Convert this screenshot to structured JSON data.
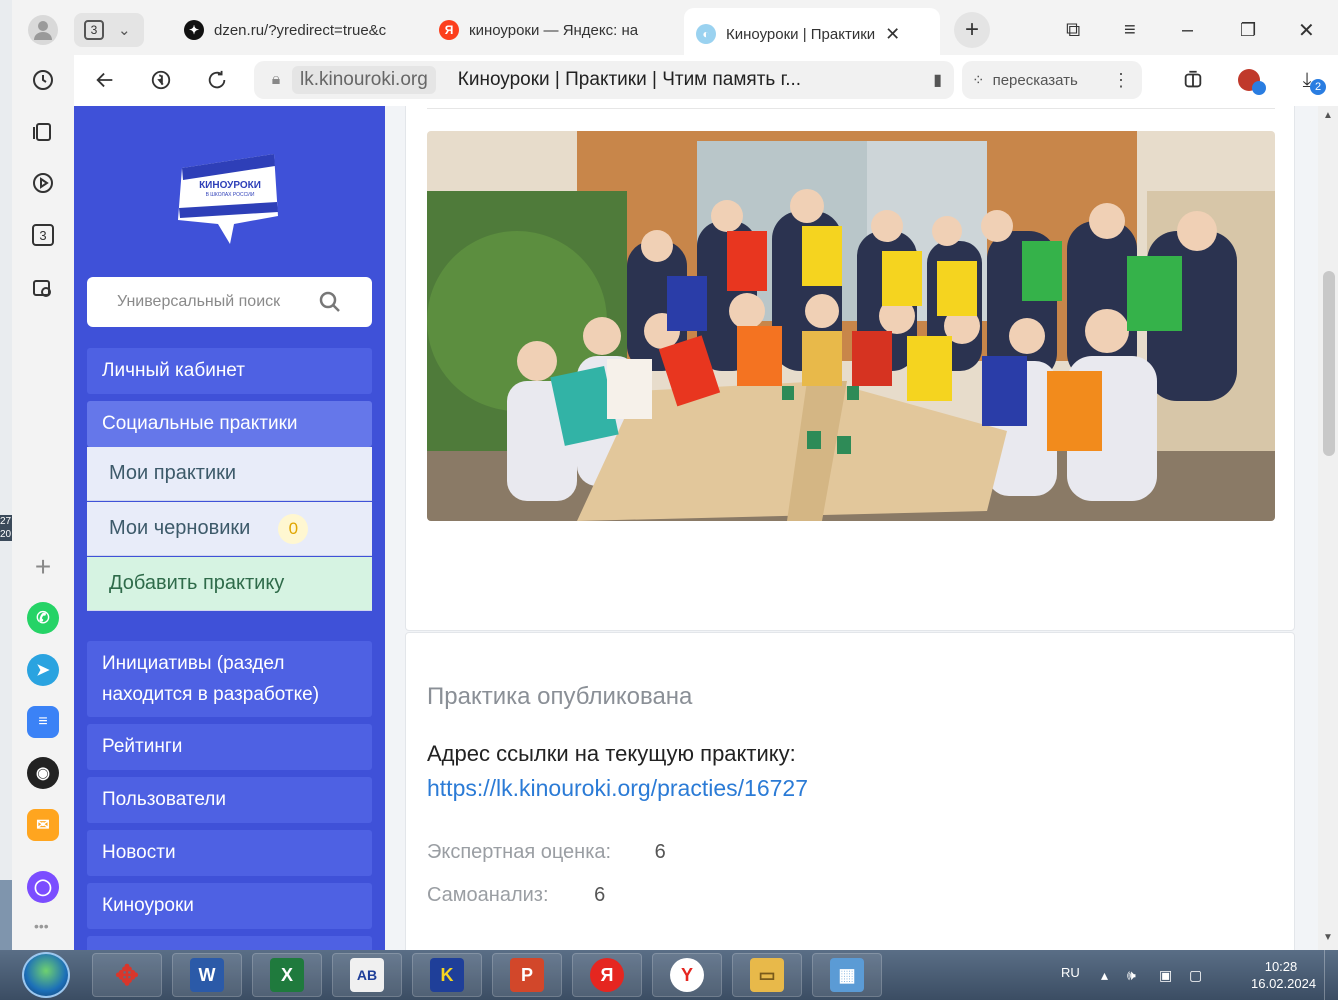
{
  "desktop": {
    "clock_fragment": "27\n20."
  },
  "sidepanel": {
    "tab_count": "3",
    "apps": [
      {
        "name": "whatsapp",
        "color": "#25d366"
      },
      {
        "name": "telegram",
        "color": "#2aa3e0"
      },
      {
        "name": "yandex-notes",
        "color": "#3b82f6"
      },
      {
        "name": "music",
        "color": "#222222"
      },
      {
        "name": "mail",
        "color": "#ffa51f"
      },
      {
        "name": "alice",
        "color": "#7b4dff"
      }
    ]
  },
  "tabs": [
    {
      "label": "dzen.ru/?yredirect=true&c",
      "icon": "dzen-icon"
    },
    {
      "label": "киноуроки — Яндекс: на",
      "icon": "yandex-icon"
    },
    {
      "label": "Киноуроки | Практики",
      "icon": "kinouroki-icon",
      "active": true
    }
  ],
  "address": {
    "domain": "lk.kinouroki.org",
    "page_title": "Киноуроки | Практики | Чтим память г...",
    "retell_label": "пересказать",
    "downloads_badge": "2"
  },
  "site": {
    "logo_title": "КИНОУРОКИ",
    "logo_subtitle": "В ШКОЛАХ РОССИИ",
    "search_placeholder": "Универсальный поиск",
    "nav": {
      "cabinet": "Личный кабинет",
      "social": "Социальные практики",
      "my_practices": "Мои практики",
      "my_drafts": "Мои черновики",
      "drafts_count": "0",
      "add_practice": "Добавить практику",
      "initiatives": "Инициативы (раздел находится в разработке)",
      "ratings": "Рейтинги",
      "users": "Пользователи",
      "news": "Новости",
      "kinouroki": "Киноуроки"
    }
  },
  "content": {
    "published_title": "Практика опубликована",
    "link_label": "Адрес ссылки на текущую практику:",
    "link_url": "https://lk.kinouroki.org/practies/16727",
    "expert_label": "Экспертная оценка:",
    "expert_value": "6",
    "self_label": "Самоанализ:",
    "self_value": "6"
  },
  "taskbar": {
    "apps": [
      {
        "name": "app-red-star",
        "glyph": "✥",
        "color": "#d9362b"
      },
      {
        "name": "word",
        "glyph": "W",
        "color": "#2b5aa8"
      },
      {
        "name": "excel",
        "glyph": "X",
        "color": "#1f7a3d"
      },
      {
        "name": "abc-net",
        "glyph": "AB",
        "color": "#f0f0f0"
      },
      {
        "name": "k-app",
        "glyph": "K",
        "color": "#1f3f99"
      },
      {
        "name": "powerpoint",
        "glyph": "P",
        "color": "#d2472a"
      },
      {
        "name": "yandex",
        "glyph": "Я",
        "color": "#e52620"
      },
      {
        "name": "yandex-browser",
        "glyph": "Y",
        "color": "#ffffff"
      },
      {
        "name": "explorer",
        "glyph": "▭",
        "color": "#e8b94a"
      },
      {
        "name": "picture-viewer",
        "glyph": "▦",
        "color": "#5b9bd5"
      }
    ],
    "lang": "RU",
    "time": "10:28",
    "date": "16.02.2024"
  }
}
